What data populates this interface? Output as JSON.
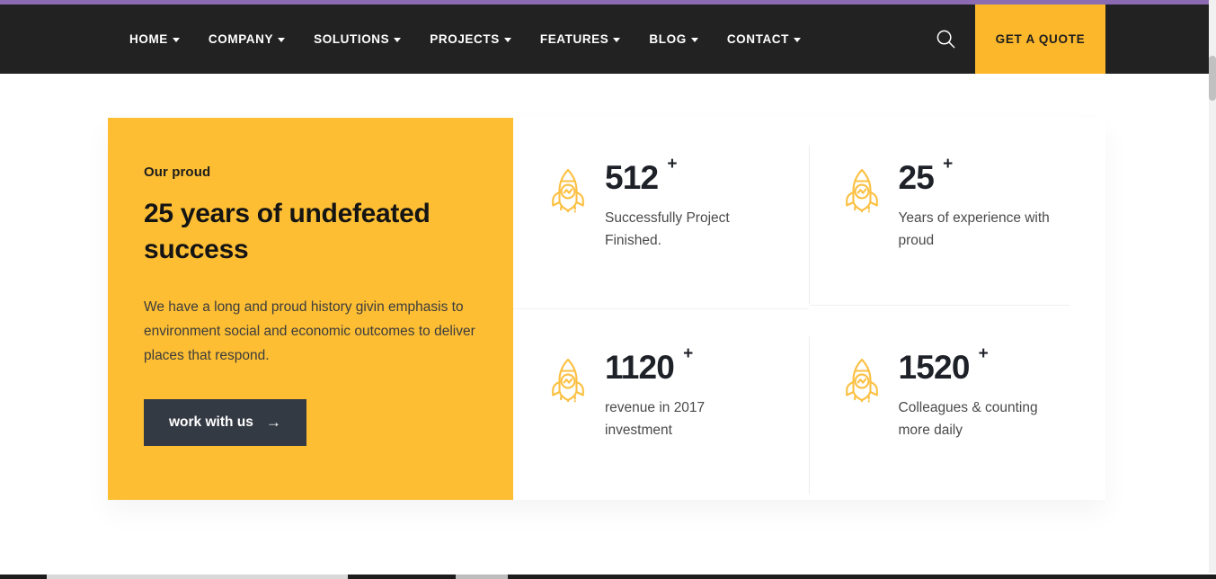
{
  "theme": {
    "accent_yellow": "#fdbe34",
    "header_dark": "#222222",
    "button_dark": "#343a44",
    "top_strip_purple": "#8b6bb1",
    "icon_yellow": "#fcc042",
    "number_dark": "#1e2128"
  },
  "header": {
    "nav_items": [
      {
        "label": "HOME",
        "has_caret": true
      },
      {
        "label": "COMPANY",
        "has_caret": true
      },
      {
        "label": "SOLUTIONS",
        "has_caret": true
      },
      {
        "label": "PROJECTS",
        "has_caret": true
      },
      {
        "label": "FEATURES",
        "has_caret": true
      },
      {
        "label": "BLOG",
        "has_caret": true
      },
      {
        "label": "CONTACT",
        "has_caret": true
      }
    ],
    "search_icon": "search-icon",
    "quote_button": "GET A QUOTE"
  },
  "promo": {
    "eyebrow": "Our proud",
    "title": "25 years of undefeated success",
    "paragraph": "We have a long and proud history givin emphasis to environment social and economic outcomes to deliver places that respond.",
    "button_label": "work with us",
    "button_arrow": "→"
  },
  "stats": [
    {
      "icon": "rocket-icon",
      "number": "512",
      "suffix": "+",
      "label": "Successfully Project Finished."
    },
    {
      "icon": "rocket-icon",
      "number": "25",
      "suffix": "+",
      "label": "Years of experience with proud"
    },
    {
      "icon": "rocket-icon",
      "number": "1120",
      "suffix": "+",
      "label": "revenue in 2017 investment"
    },
    {
      "icon": "rocket-icon",
      "number": "1520",
      "suffix": "+",
      "label": "Colleagues & counting more daily"
    }
  ]
}
